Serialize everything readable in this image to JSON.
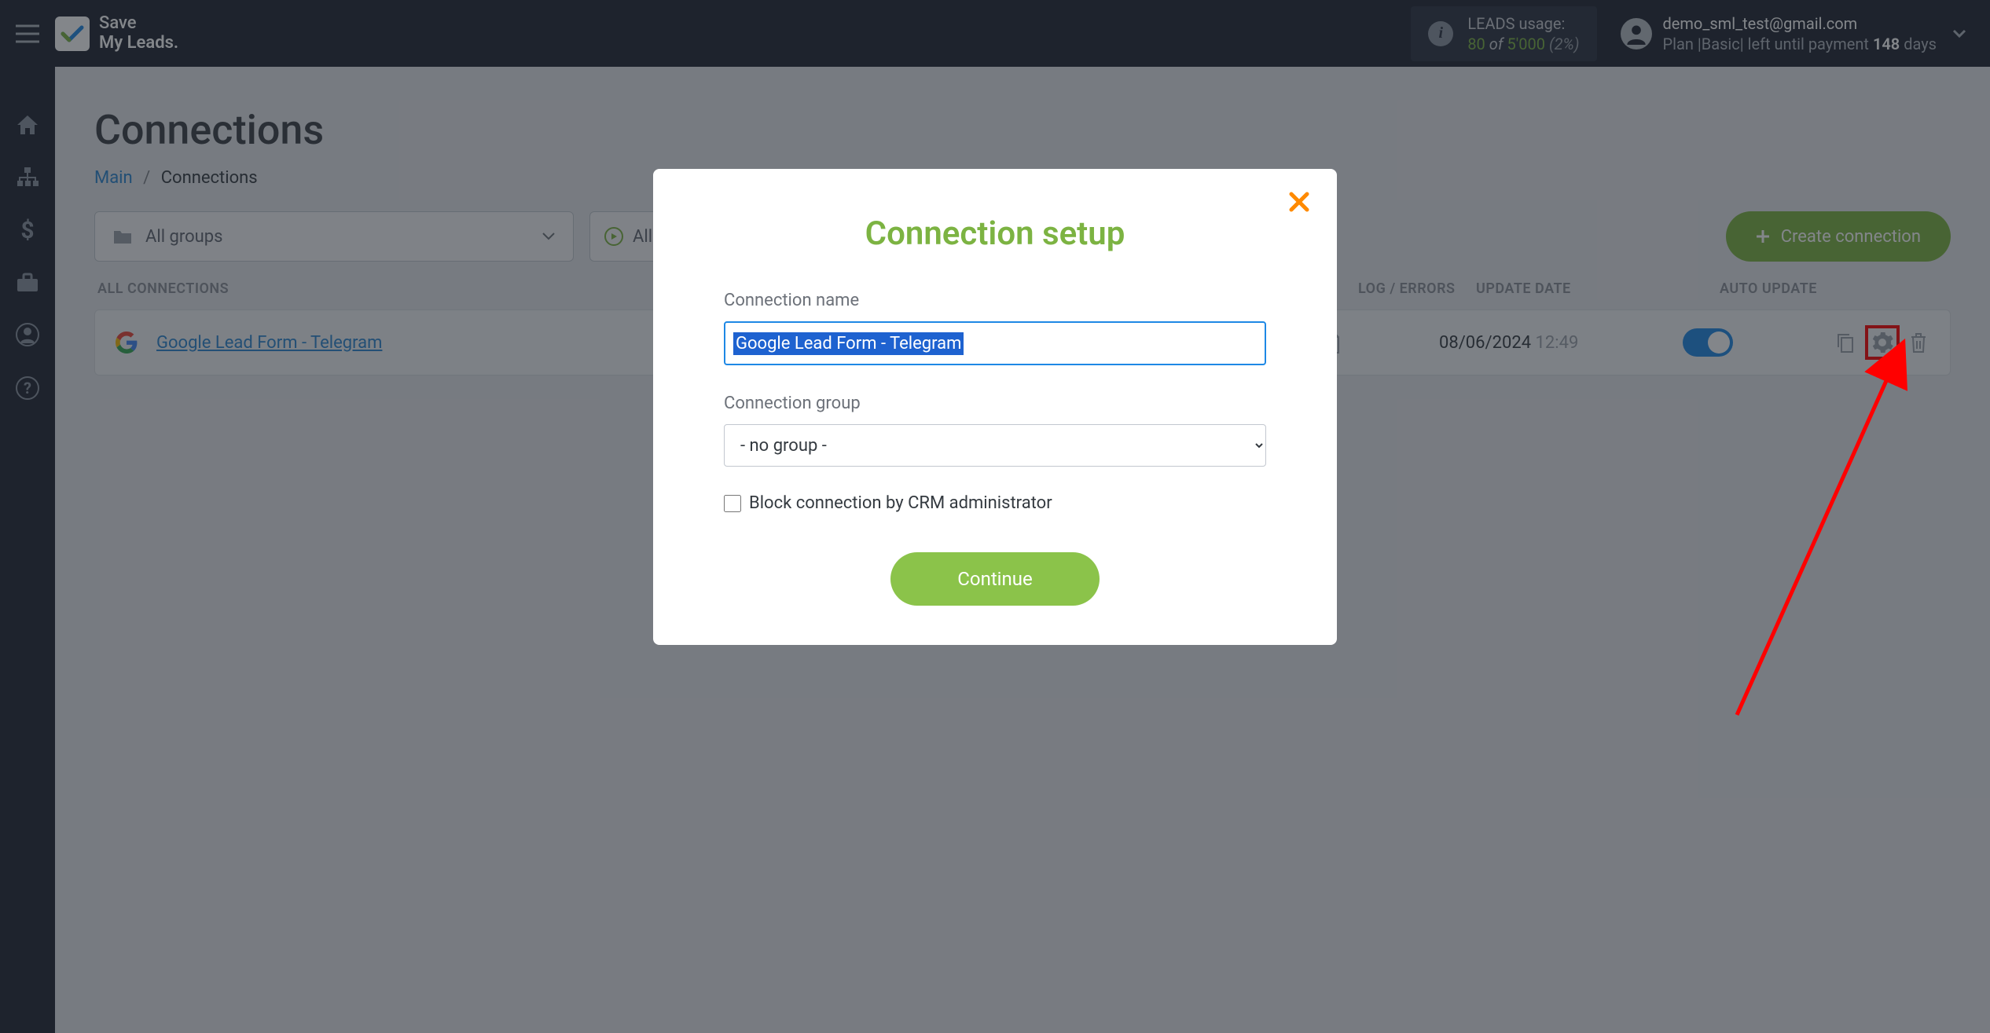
{
  "header": {
    "logo_line1": "Save",
    "logo_line2": "My Leads.",
    "leads_label": "LEADS usage:",
    "leads_used": "80",
    "leads_of": "of",
    "leads_total": "5'000",
    "leads_pct": "(2%)",
    "user_email": "demo_sml_test@gmail.com",
    "plan_prefix": "Plan |",
    "plan_name": "Basic",
    "plan_suffix": "| left until payment",
    "plan_days": "148",
    "plan_days_unit": "days"
  },
  "page": {
    "title": "Connections",
    "breadcrumb_main": "Main",
    "breadcrumb_current": "Connections"
  },
  "filters": {
    "groups_label": "All groups",
    "actions_label": "All actions",
    "create_btn": "Create connection"
  },
  "columns": {
    "all": "ALL CONNECTIONS",
    "log": "LOG / ERRORS",
    "date": "UPDATE DATE",
    "auto": "AUTO UPDATE"
  },
  "row": {
    "name": "Google Lead Form - Telegram",
    "date": "08/06/2024",
    "time": "12:49"
  },
  "modal": {
    "title": "Connection setup",
    "name_label": "Connection name",
    "name_value": "Google Lead Form - Telegram",
    "group_label": "Connection group",
    "group_value": "- no group -",
    "block_label": "Block connection by CRM administrator",
    "continue": "Continue"
  }
}
